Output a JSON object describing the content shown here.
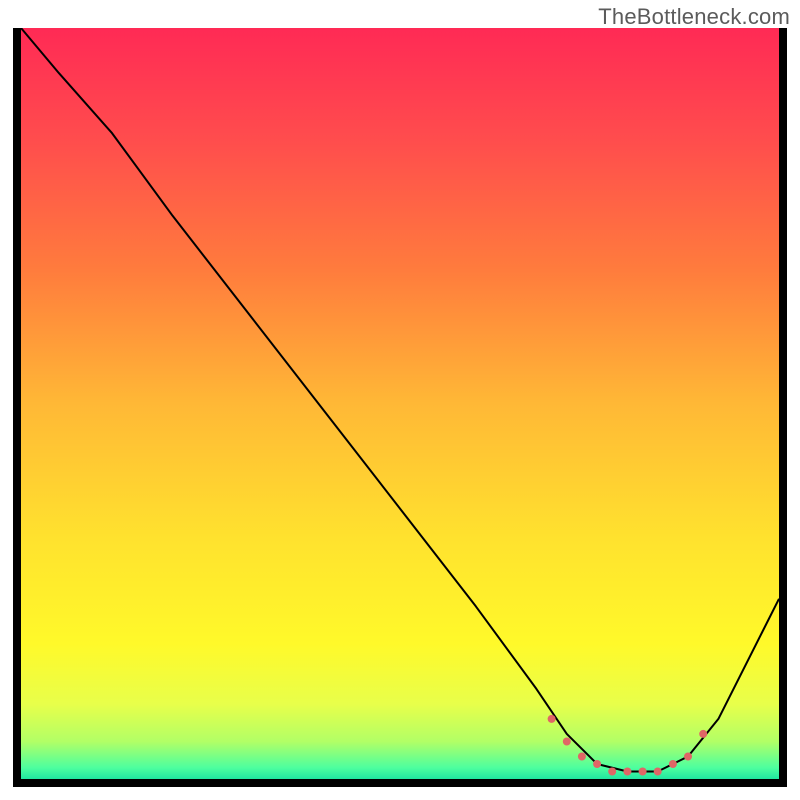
{
  "attribution": "TheBottleneck.com",
  "chart_data": {
    "type": "line",
    "title": "",
    "xlabel": "",
    "ylabel": "",
    "xlim": [
      0,
      100
    ],
    "ylim": [
      0,
      100
    ],
    "grid": false,
    "background": "rainbow-gradient-vertical",
    "gradient_stops": [
      {
        "offset": 0.0,
        "color": "#ff2a55"
      },
      {
        "offset": 0.15,
        "color": "#ff4d4d"
      },
      {
        "offset": 0.32,
        "color": "#ff7b3d"
      },
      {
        "offset": 0.5,
        "color": "#ffb836"
      },
      {
        "offset": 0.68,
        "color": "#ffe22e"
      },
      {
        "offset": 0.82,
        "color": "#fff92a"
      },
      {
        "offset": 0.9,
        "color": "#e8ff4a"
      },
      {
        "offset": 0.95,
        "color": "#b2ff66"
      },
      {
        "offset": 0.985,
        "color": "#4dff9f"
      },
      {
        "offset": 1.0,
        "color": "#20e6a0"
      }
    ],
    "series": [
      {
        "name": "bottleneck-curve",
        "stroke": "#000000",
        "stroke_width": 2,
        "x": [
          0,
          5,
          12,
          20,
          30,
          40,
          50,
          60,
          68,
          72,
          76,
          80,
          84,
          88,
          92,
          100
        ],
        "values": [
          100,
          94,
          86,
          75,
          62,
          49,
          36,
          23,
          12,
          6,
          2,
          1,
          1,
          3,
          8,
          24
        ]
      },
      {
        "name": "optimal-band-markers",
        "type": "scatter",
        "stroke": "#e06666",
        "fill": "#e06666",
        "marker_size": 8,
        "x": [
          70,
          72,
          74,
          76,
          78,
          80,
          82,
          84,
          86,
          88,
          90
        ],
        "values": [
          8,
          5,
          3,
          2,
          1,
          1,
          1,
          1,
          2,
          3,
          6
        ]
      }
    ],
    "annotations": []
  }
}
